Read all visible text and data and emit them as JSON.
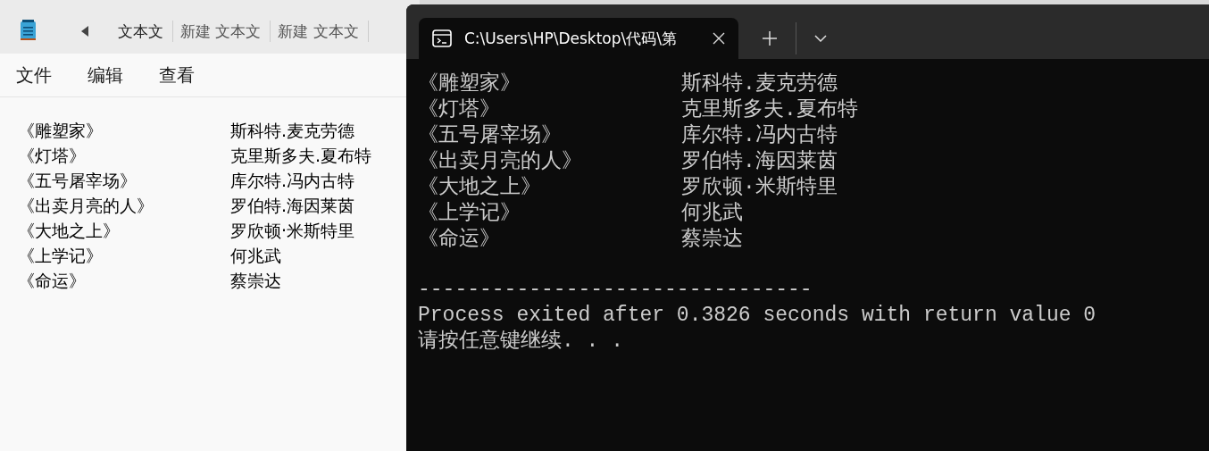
{
  "notepad": {
    "tabs": [
      {
        "label": "文本文",
        "selected": true
      },
      {
        "label": "新建 文本文",
        "selected": false
      },
      {
        "label": "新建 文本文",
        "selected": false
      }
    ],
    "menu": [
      "文件",
      "编辑",
      "查看"
    ],
    "lines": [
      {
        "title": "《雕塑家》",
        "author": "斯科特.麦克劳德"
      },
      {
        "title": "《灯塔》",
        "author": "克里斯多夫.夏布特"
      },
      {
        "title": "《五号屠宰场》",
        "author": "库尔特.冯内古特"
      },
      {
        "title": "《出卖月亮的人》",
        "author": "罗伯特.海因莱茵"
      },
      {
        "title": "《大地之上》",
        "author": "罗欣顿·米斯特里"
      },
      {
        "title": "《上学记》",
        "author": "何兆武"
      },
      {
        "title": "《命运》",
        "author": "蔡崇达"
      }
    ]
  },
  "terminal": {
    "tab_title": "C:\\Users\\HP\\Desktop\\代码\\第",
    "lines": [
      {
        "title": "《雕塑家》",
        "author": "斯科特.麦克劳德"
      },
      {
        "title": "《灯塔》",
        "author": "克里斯多夫.夏布特"
      },
      {
        "title": "《五号屠宰场》",
        "author": "库尔特.冯内古特"
      },
      {
        "title": "《出卖月亮的人》",
        "author": "罗伯特.海因莱茵"
      },
      {
        "title": "《大地之上》",
        "author": "罗欣顿·米斯特里"
      },
      {
        "title": "《上学记》",
        "author": "何兆武"
      },
      {
        "title": "《命运》",
        "author": "蔡崇达"
      }
    ],
    "separator": "--------------------------------",
    "exit_message": "Process exited after 0.3826 seconds with return value 0",
    "prompt": "请按任意键继续. . ."
  }
}
